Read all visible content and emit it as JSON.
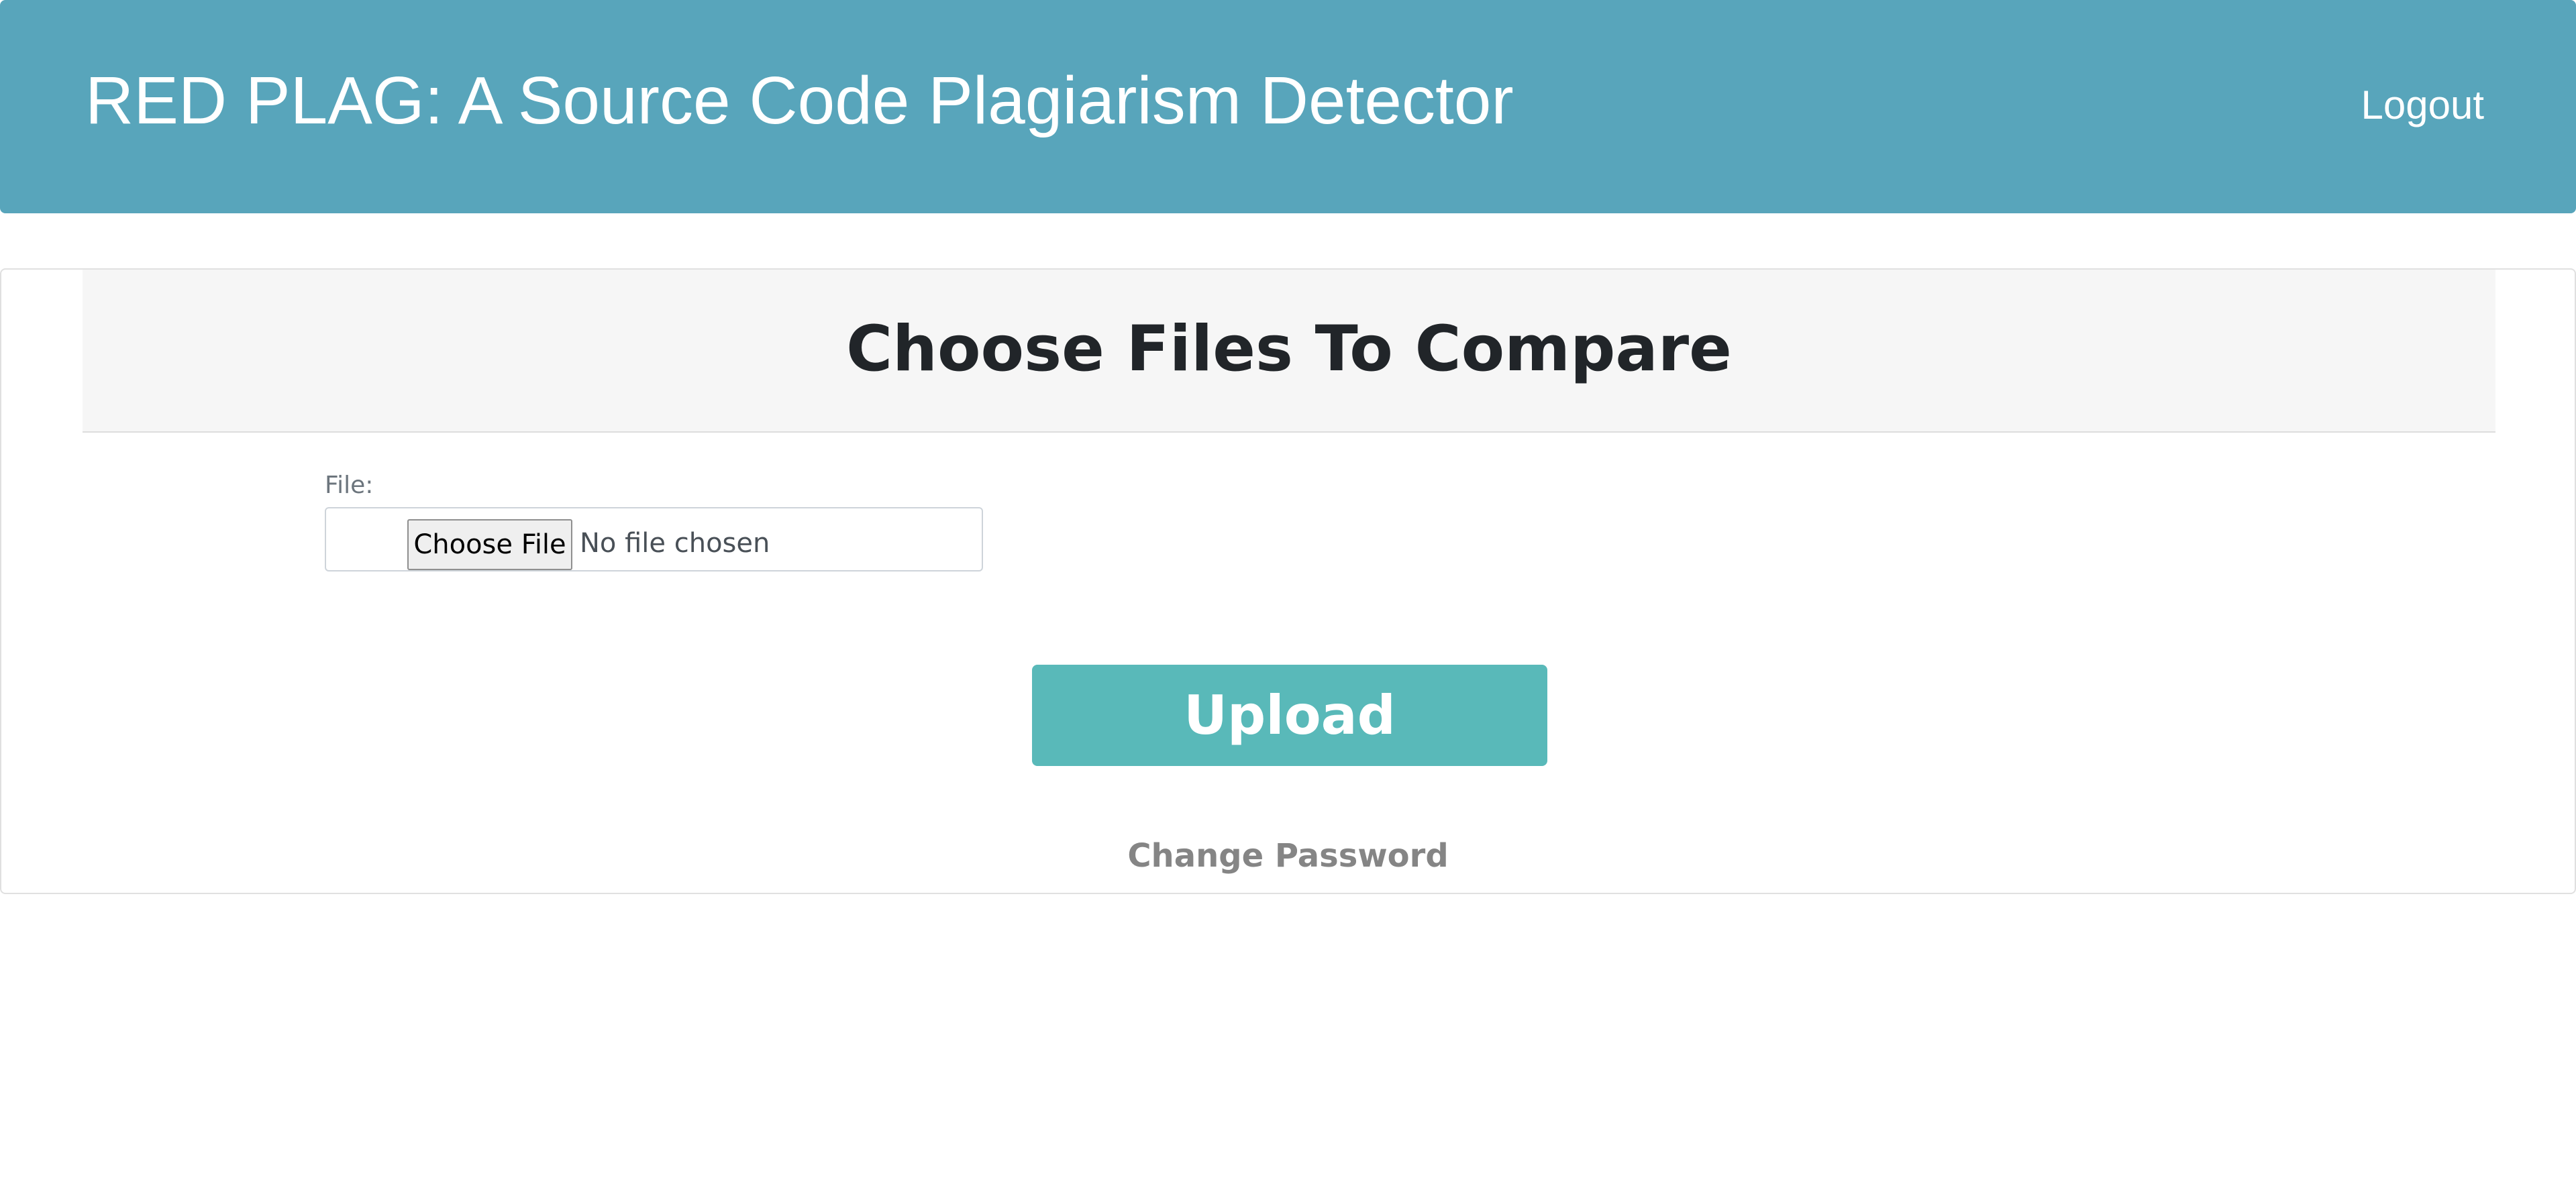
{
  "header": {
    "title": "RED PLAG: A Source Code Plagiarism Detector",
    "logout_label": "Logout",
    "background_color": "#58a5bb"
  },
  "card": {
    "heading": "Choose Files To Compare",
    "file_field": {
      "label": "File:",
      "button_label": "Choose File",
      "status_text": "No file chosen"
    },
    "upload_label": "Upload",
    "upload_color": "#59b9b9",
    "change_password_label": "Change Password"
  }
}
